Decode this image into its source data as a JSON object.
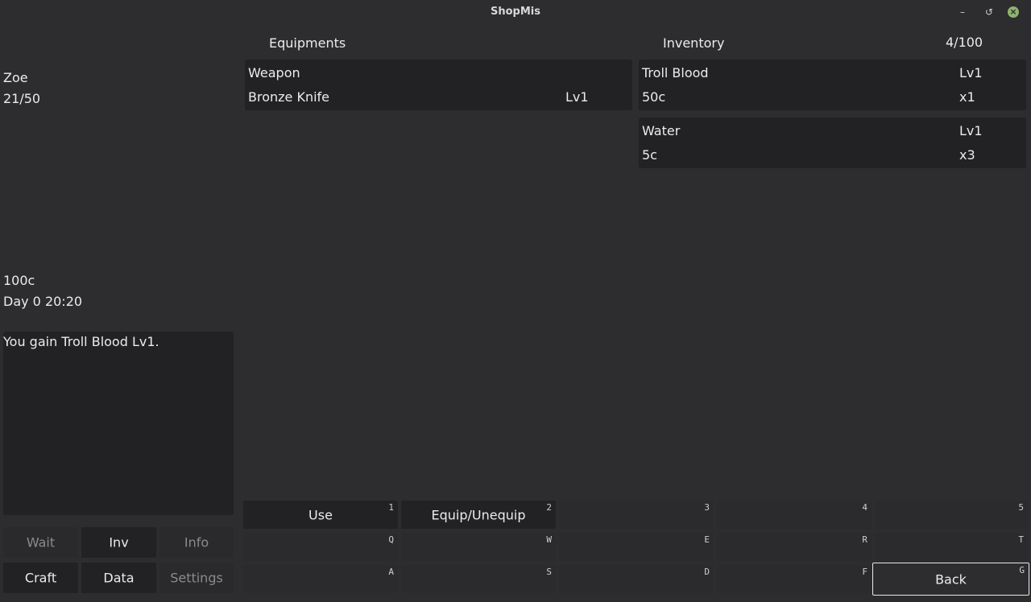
{
  "window": {
    "title": "ShopMis"
  },
  "player": {
    "name": "Zoe",
    "hp": "21/50",
    "money": "100c",
    "time": "Day 0 20:20"
  },
  "log": {
    "message": "You gain Troll Blood Lv1."
  },
  "nav": {
    "wait": "Wait",
    "inv": "Inv",
    "info": "Info",
    "craft": "Craft",
    "data": "Data",
    "settings": "Settings"
  },
  "equipments": {
    "header": "Equipments",
    "items": [
      {
        "slot": "Weapon",
        "name": "Bronze Knife",
        "level": "Lv1"
      }
    ]
  },
  "inventory": {
    "header": "Inventory",
    "count": "4/100",
    "items": [
      {
        "name": "Troll Blood",
        "level": "Lv1",
        "price": "50c",
        "qty": "x1"
      },
      {
        "name": "Water",
        "level": "Lv1",
        "price": "5c",
        "qty": "x3"
      }
    ]
  },
  "actions": {
    "row1": [
      {
        "label": "Use",
        "key": "1"
      },
      {
        "label": "Equip/Unequip",
        "key": "2"
      },
      {
        "label": "",
        "key": "3"
      },
      {
        "label": "",
        "key": "4"
      },
      {
        "label": "",
        "key": "5"
      }
    ],
    "row2": [
      {
        "label": "",
        "key": "Q"
      },
      {
        "label": "",
        "key": "W"
      },
      {
        "label": "",
        "key": "E"
      },
      {
        "label": "",
        "key": "R"
      },
      {
        "label": "",
        "key": "T"
      }
    ],
    "row3": [
      {
        "label": "",
        "key": "A"
      },
      {
        "label": "",
        "key": "S"
      },
      {
        "label": "",
        "key": "D"
      },
      {
        "label": "",
        "key": "F"
      },
      {
        "label": "Back",
        "key": "G"
      }
    ]
  }
}
